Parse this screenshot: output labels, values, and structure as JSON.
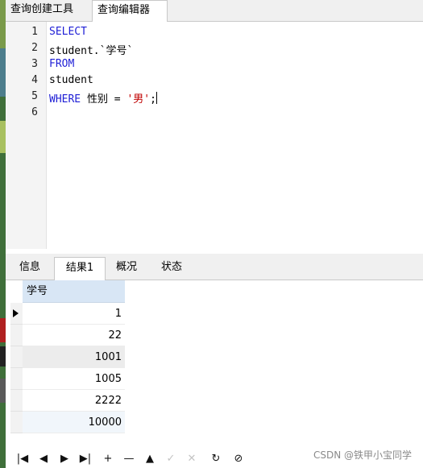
{
  "top_tabs": [
    {
      "label": "查询创建工具"
    },
    {
      "label": "查询编辑器"
    }
  ],
  "editor": {
    "line_numbers": [
      "1",
      "2",
      "3",
      "4",
      "5",
      "6"
    ],
    "lines": [
      {
        "kw": "SELECT"
      },
      {
        "text": "student.`学号`"
      },
      {
        "kw": "FROM"
      },
      {
        "text": "student"
      },
      {
        "kw": "WHERE",
        "text": " 性别 = ",
        "str": "'男'",
        "tail": ";"
      },
      {
        "text": ""
      }
    ]
  },
  "result_tabs": [
    {
      "label": "信息"
    },
    {
      "label": "结果1"
    },
    {
      "label": "概况"
    },
    {
      "label": "状态"
    }
  ],
  "grid": {
    "column": "学号",
    "rows": [
      "1",
      "22",
      "1001",
      "1005",
      "2222",
      "10000"
    ]
  },
  "nav_icons": [
    "first-record-icon",
    "previous-record-icon",
    "next-record-icon",
    "last-record-icon",
    "add-record-icon",
    "delete-record-icon",
    "apply-icon",
    "confirm-icon",
    "discard-icon",
    "refresh-icon",
    "stop-icon"
  ],
  "nav_glyphs": [
    "|◀",
    "◀",
    "▶",
    "▶|",
    "+",
    "—",
    "▲",
    "✓",
    "✕",
    "↻",
    "⊘"
  ],
  "watermark": "CSDN @铁甲小宝同学"
}
